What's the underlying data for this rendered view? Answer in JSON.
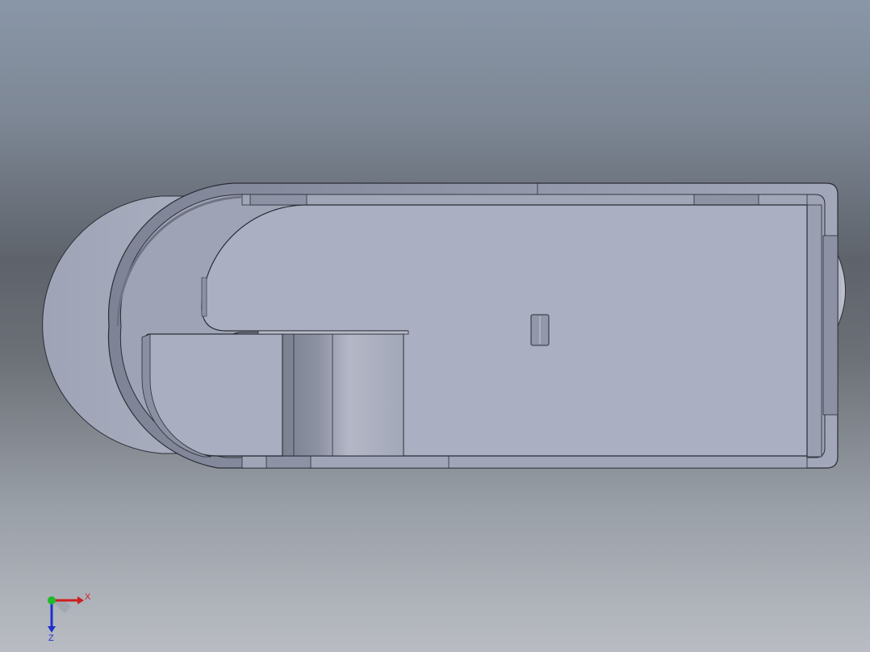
{
  "app": {
    "view": "top"
  },
  "triad": {
    "x_label": "X",
    "z_label": "Z",
    "x_color": "#cc1f1f",
    "y_color": "#1fbb2a",
    "z_color": "#1f2fcc"
  },
  "colors": {
    "part_face": "#a7acbf",
    "part_shadow": "#8f94a6",
    "part_dark": "#7a7e8e",
    "edge": "#2b2d35"
  }
}
